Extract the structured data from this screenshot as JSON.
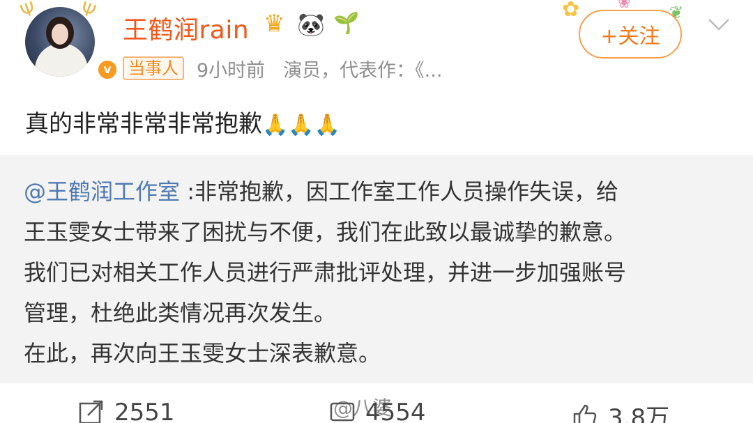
{
  "post": {
    "username": "王鹤润rain",
    "badge_icons": [
      "crown-icon",
      "panda-icon",
      "sprout-icon"
    ],
    "tag": "当事人",
    "time": "9小时前",
    "intro": "演员，代表作：《...",
    "follow_label": "+关注",
    "verified_mark": "v",
    "content": "真的非常非常非常抱歉",
    "content_emoji": "🙏🙏🙏"
  },
  "repost": {
    "mention": "@王鹤润工作室",
    "lines": [
      " :非常抱歉，因工作室工作人员操作失误，给",
      "王玉雯女士带来了困扰与不便，我们在此致以最诚挚的歉意。",
      "我们已对相关工作人员进行严肃批评处理，并进一步加强账号",
      "管理，杜绝此类情况再次发生。",
      "在此，再次向王玉雯女士深表歉意。"
    ]
  },
  "actions": {
    "share_count": "2551",
    "comment_count": "4554",
    "like_count": "3.8万"
  },
  "watermark": "@八婆",
  "colors": {
    "username": "#f0571a",
    "mention": "#4f79b2",
    "follow": "#f07a1a",
    "repost_bg": "#f3f3f3"
  }
}
